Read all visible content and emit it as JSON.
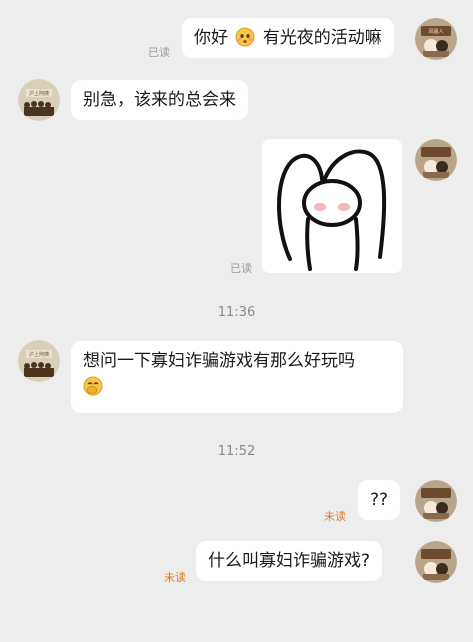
{
  "messages": {
    "m1": {
      "text_a": "你好",
      "text_b": "有光夜的活动嘛",
      "status": "已读",
      "emoji": "shy-face-emoji"
    },
    "m2": {
      "text": "别急，该来的总会来"
    },
    "m3": {
      "status": "已读",
      "sticker": "arms-up-blush-sticker"
    },
    "m4": {
      "text": "想问一下寡妇诈骗游戏有那么好玩吗",
      "emoji": "laughing-cover-mouth-emoji"
    },
    "m5": {
      "text": "??",
      "status": "未读"
    },
    "m6": {
      "text": "什么叫寡妇诈骗游戏?",
      "status": "未读"
    }
  },
  "timestamps": {
    "t1": "11:36",
    "t2": "11:52"
  },
  "avatars": {
    "other_logo_text": "沪上阿姨",
    "self_logo_text": "风骚人"
  },
  "colors": {
    "background": "#ededed",
    "bubble": "#ffffff",
    "unread": "#e07a1c",
    "read": "#9a9a9a"
  }
}
